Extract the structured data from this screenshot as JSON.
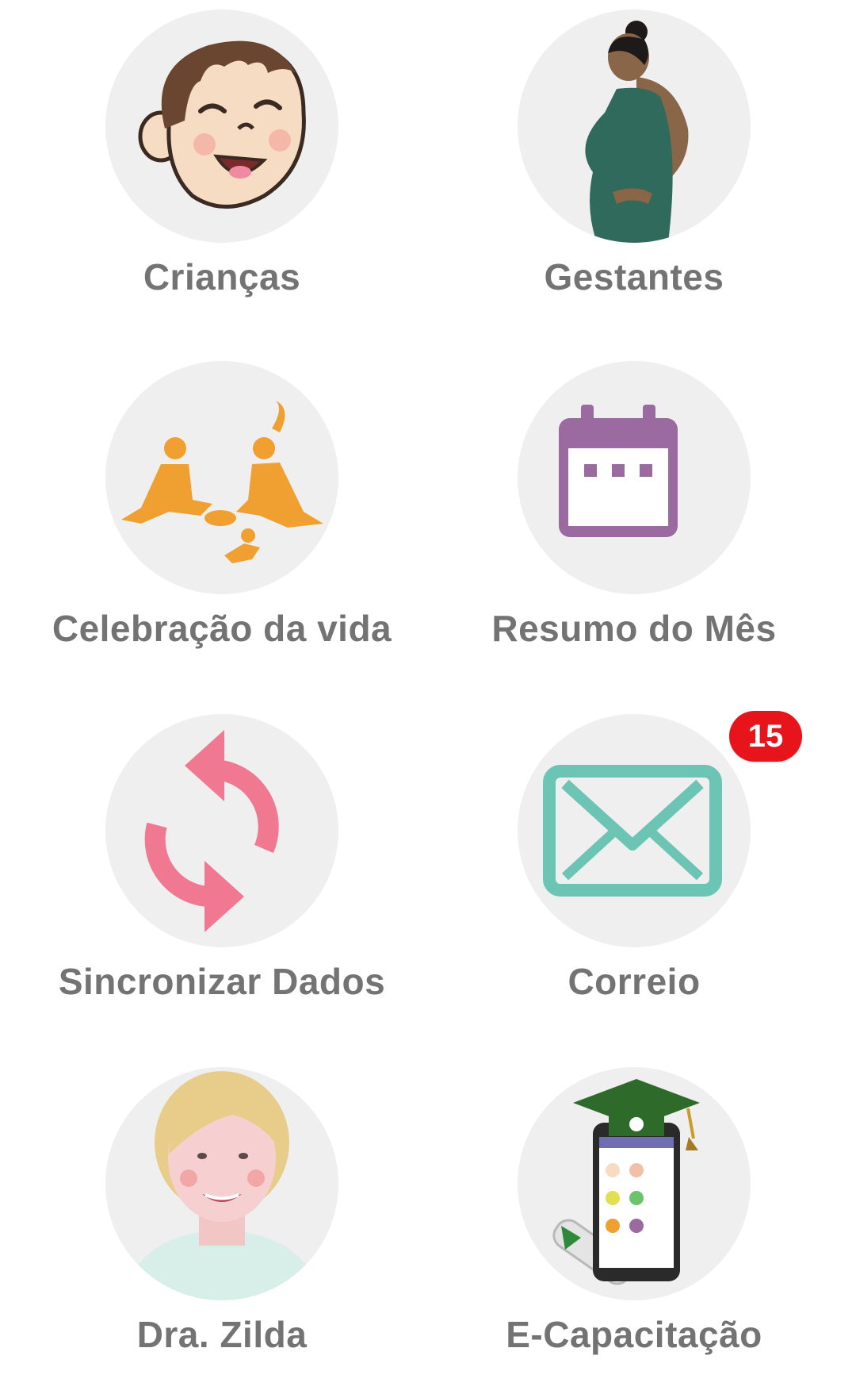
{
  "menu": {
    "items": [
      {
        "label": "Crianças",
        "icon": "baby-face-icon"
      },
      {
        "label": "Gestantes",
        "icon": "pregnant-woman-icon"
      },
      {
        "label": "Celebração da vida",
        "icon": "celebration-of-life-icon"
      },
      {
        "label": "Resumo do Mês",
        "icon": "calendar-icon"
      },
      {
        "label": "Sincronizar Dados",
        "icon": "sync-icon"
      },
      {
        "label": "Correio",
        "icon": "mail-icon",
        "badge": "15"
      },
      {
        "label": "Dra. Zilda",
        "icon": "dra-zilda-portrait-icon"
      },
      {
        "label": "E-Capacitação",
        "icon": "graduation-phone-icon"
      }
    ]
  },
  "colors": {
    "label": "#737373",
    "circle": "#efefef",
    "badge": "#e8141c",
    "calendar": "#9a6aa0",
    "sync": "#f07890",
    "mail": "#6cc4b4",
    "celebration": "#f0a030",
    "dress": "#2f6a5c"
  }
}
